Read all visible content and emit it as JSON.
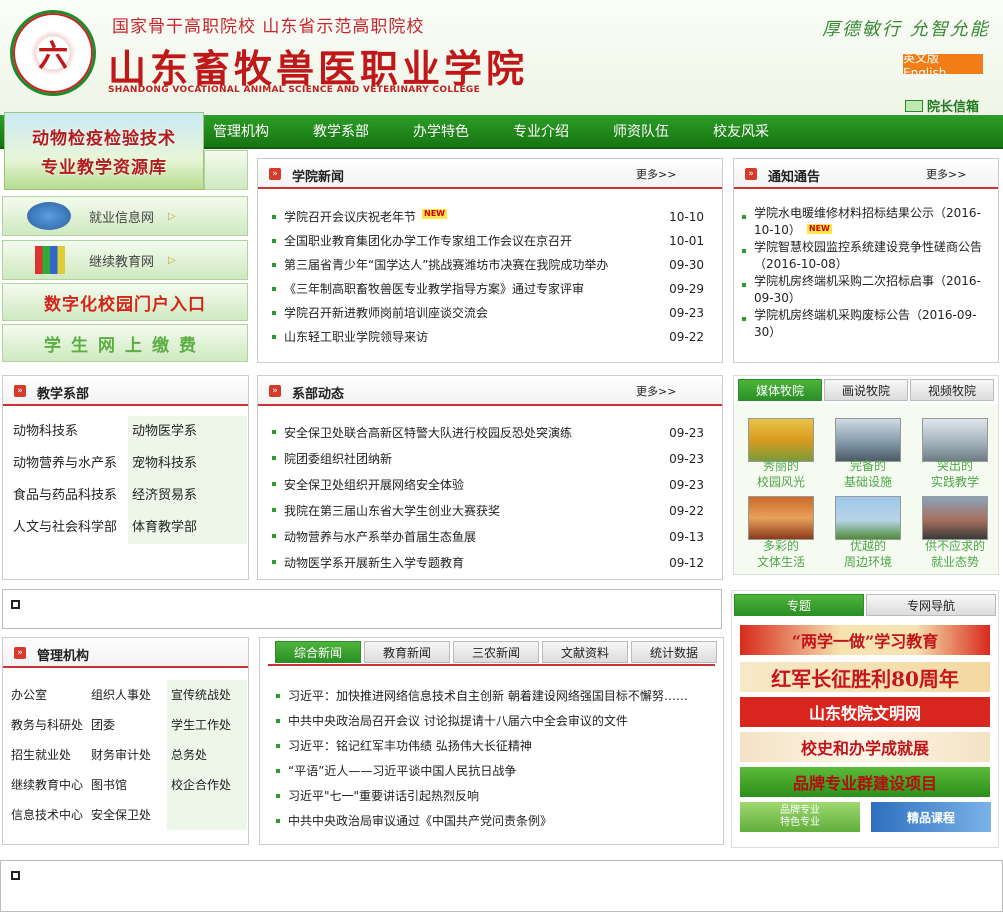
{
  "header": {
    "slogan": "国家骨干高职院校  山东省示范高职院校",
    "college_cn": "山东畜牧兽医职业学院",
    "college_en": "SHANDONG VOCATIONAL ANIMAL SCIENCE AND VETERINARY COLLEGE",
    "motto": "厚德敏行  允智允能",
    "english_label": "英文版 English",
    "mailbox_label": "院长信箱"
  },
  "nav": {
    "items": [
      "管理机构",
      "教学系部",
      "办学特色",
      "专业介绍",
      "师资队伍",
      "校友风采"
    ]
  },
  "resource_banner": {
    "line1": "动物检疫检验技术",
    "line2": "专业教学资源库"
  },
  "side_links": {
    "employment": "就业信息网",
    "continuing": "继续教育网",
    "portal": "数字化校园门户入口",
    "payment": "学生网上缴费"
  },
  "college_news": {
    "title": "学院新闻",
    "more": "更多>>",
    "new_badge": "NEW",
    "items": [
      {
        "text": "学院召开会议庆祝老年节",
        "date": "10-10",
        "new": true
      },
      {
        "text": "全国职业教育集团化办学工作专家组工作会议在京召开",
        "date": "10-01"
      },
      {
        "text": "第三届省青少年“国学达人”挑战赛潍坊市决赛在我院成功举办",
        "date": "09-30"
      },
      {
        "text": "《三年制高职畜牧兽医专业教学指导方案》通过专家评审",
        "date": "09-29"
      },
      {
        "text": "学院召开新进教师岗前培训座谈交流会",
        "date": "09-23"
      },
      {
        "text": "山东轻工职业学院领导来访",
        "date": "09-22"
      }
    ]
  },
  "notices": {
    "title": "通知通告",
    "more": "更多>>",
    "items": [
      {
        "text": "学院水电暖维修材料招标结果公示（2016-10-10）",
        "new": true
      },
      {
        "text": "学院智慧校园监控系统建设竞争性磋商公告（2016-10-08）"
      },
      {
        "text": "学院机房终端机采购二次招标启事（2016-09-30）"
      },
      {
        "text": "学院机房终端机采购废标公告（2016-09-30）"
      }
    ]
  },
  "departments": {
    "title": "教学系部",
    "items": [
      "动物科技系",
      "动物医学系",
      "动物营养与水产系",
      "宠物科技系",
      "食品与药品科技系",
      "经济贸易系",
      "人文与社会科学部",
      "体育教学部"
    ]
  },
  "dept_news": {
    "title": "系部动态",
    "more": "更多>>",
    "items": [
      {
        "text": "安全保卫处联合高新区特警大队进行校园反恐处突演练",
        "date": "09-23"
      },
      {
        "text": "院团委组织社团纳新",
        "date": "09-23"
      },
      {
        "text": "安全保卫处组织开展网络安全体验",
        "date": "09-23"
      },
      {
        "text": "我院在第三届山东省大学生创业大赛获奖",
        "date": "09-22"
      },
      {
        "text": "动物营养与水产系举办首届生态鱼展",
        "date": "09-13"
      },
      {
        "text": "动物医学系开展新生入学专题教育",
        "date": "09-12"
      }
    ]
  },
  "media_tabs": [
    "媒体牧院",
    "画说牧院",
    "视频牧院"
  ],
  "media_photos": [
    {
      "l1": "秀丽的",
      "l2": "校园风光"
    },
    {
      "l1": "完备的",
      "l2": "基础设施"
    },
    {
      "l1": "突出的",
      "l2": "实践教学"
    },
    {
      "l1": "多彩的",
      "l2": "文体生活"
    },
    {
      "l1": "优越的",
      "l2": "周边环境"
    },
    {
      "l1": "供不应求的",
      "l2": "就业态势"
    }
  ],
  "management": {
    "title": "管理机构",
    "items": [
      "办公室",
      "组织人事处",
      "宣传统战处",
      "教务与科研处",
      "团委",
      "学生工作处",
      "招生就业处",
      "财务审计处",
      "总务处",
      "继续教育中心",
      "图书馆",
      "校企合作处",
      "信息技术中心",
      "安全保卫处",
      ""
    ]
  },
  "news_tabs": [
    "综合新闻",
    "教育新闻",
    "三农新闻",
    "文献资料",
    "统计数据"
  ],
  "general_news": [
    "习近平：加快推进网络信息技术自主创新  朝着建设网络强国目标不懈努……",
    "中共中央政治局召开会议  讨论拟提请十八届六中全会审议的文件",
    "习近平：铭记红军丰功伟绩  弘扬伟大长征精神",
    "“平语”近人——习近平谈中国人民抗日战争",
    "习近平\"七一\"重要讲话引起热烈反响",
    "中共中央政治局审议通过《中国共产党问责条例》"
  ],
  "topic_tabs": [
    "专题",
    "专网导航"
  ],
  "topics": {
    "t1": "“两学一做”学习教育",
    "t2": "红军长征胜利80周年",
    "t3": "山东牧院文明网",
    "t4": "校史和办学成就展",
    "t5": "品牌专业群建设项目",
    "t6a": "品牌专业",
    "t6b": "特色专业",
    "t7": "精品课程"
  }
}
